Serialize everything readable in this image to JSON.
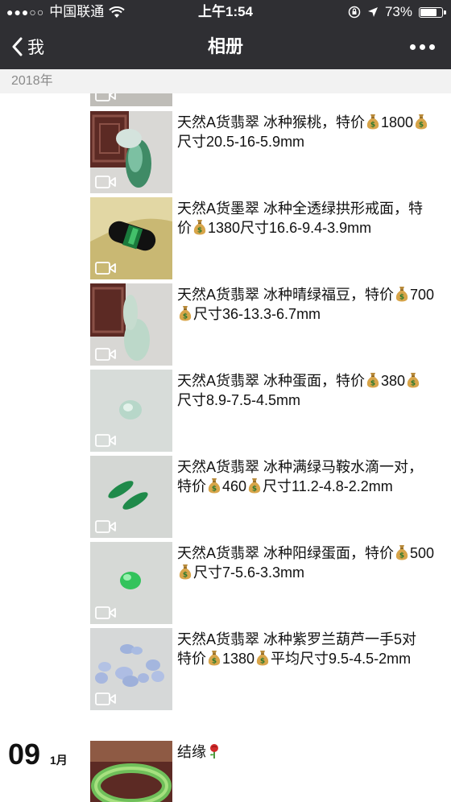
{
  "status_bar": {
    "carrier": "中国联通",
    "time": "上午1:54",
    "battery": "73%",
    "battery_level": 0.73,
    "icons": [
      "signal-dots",
      "wifi-icon",
      "orientation-lock-icon",
      "location-arrow-icon",
      "battery-icon"
    ]
  },
  "nav": {
    "back_label": "我",
    "title": "相册",
    "more_icon": "more-dots-icon"
  },
  "year_header": "2018年",
  "icons": {
    "money_bag": "money-bag-emoji",
    "video": "video-camera-icon",
    "rose": "rose-emoji"
  },
  "posts": [
    {
      "parts": [
        "天然A货翡翠 冰种猴桃，特价",
        "1800",
        "尺寸20.5-16-5.9mm"
      ]
    },
    {
      "parts": [
        "天然A货墨翠 冰种全透绿拱形戒面，特价",
        "1380尺寸16.6-9.4-3.9mm"
      ]
    },
    {
      "parts": [
        "天然A货翡翠 冰种晴绿福豆，特价",
        "700",
        "尺寸36-13.3-6.7mm"
      ]
    },
    {
      "parts": [
        "天然A货翡翠 冰种蛋面，特价",
        "380",
        "尺寸8.9-7.5-4.5mm"
      ]
    },
    {
      "parts": [
        "天然A货翡翠 冰种满绿马鞍水滴一对，特价",
        "460",
        "尺寸11.2-4.8-2.2mm"
      ]
    },
    {
      "parts": [
        "天然A货翡翠 冰种阳绿蛋面，特价",
        "500",
        "尺寸7-5.6-3.3mm"
      ]
    },
    {
      "parts": [
        "天然A货翡翠 冰种紫罗兰葫芦一手5对 特价",
        "1380",
        "平均尺寸9.5-4.5-2mm"
      ]
    }
  ],
  "date_group": {
    "day": "09",
    "month": "1月"
  },
  "last_post": {
    "text": "结缘"
  }
}
